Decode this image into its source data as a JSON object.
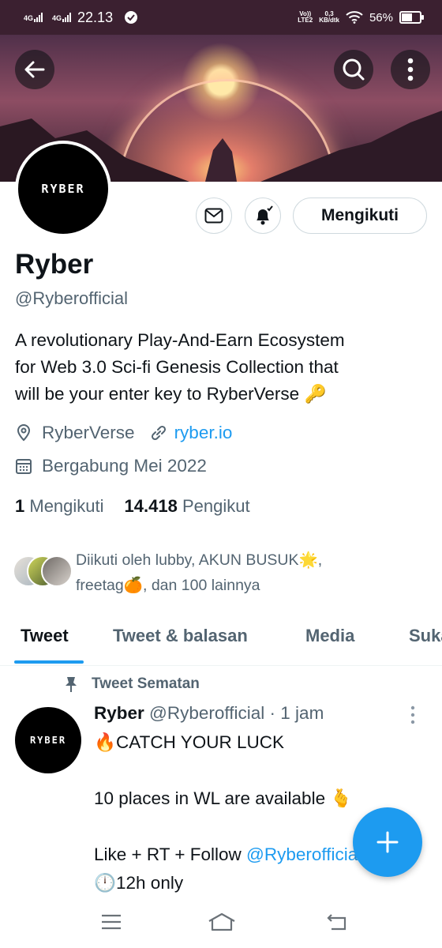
{
  "status_bar": {
    "network1": "4G",
    "network2": "4G",
    "time": "22.13",
    "volte_top": "Vo))",
    "volte_bottom": "LTE2",
    "speed_value": "0,3",
    "speed_unit": "KB/dtk",
    "battery": "56%",
    "battery_level": 0.56
  },
  "header": {
    "back_icon": "arrow-left-icon",
    "search_icon": "search-icon",
    "more_icon": "more-vertical-icon"
  },
  "profile": {
    "avatar_logo": "RYBER",
    "name": "Ryber",
    "handle": "@Ryberofficial",
    "bio_line1": "A revolutionary Play-And-Earn Ecosystem",
    "bio_line2": "for Web 3.0 Sci-fi Genesis Collection that",
    "bio_line3": "will be your enter key to RyberVerse",
    "bio_emoji": "🔑",
    "location": "RyberVerse",
    "website": "ryber.io",
    "joined": "Bergabung Mei 2022",
    "following_count": "1",
    "following_label": "Mengikuti",
    "followers_count": "14.418",
    "followers_label": "Pengikut",
    "follow_button": "Mengikuti"
  },
  "followed_by": {
    "line1": "Diikuti oleh lubby, AKUN BUSUK🌟,",
    "line2": "freetag🍊, dan 100 lainnya"
  },
  "tabs": [
    {
      "label": "Tweet"
    },
    {
      "label": "Tweet & balasan"
    },
    {
      "label": "Media"
    },
    {
      "label": "Suka"
    }
  ],
  "pinned_tweet": {
    "pinned_label": "Tweet Sematan",
    "author_name": "Ryber",
    "author_handle": "@Ryberofficial",
    "time": "· 1 jam",
    "line1": "🔥CATCH YOUR LUCK",
    "line2": "10 places in WL are available 🫰",
    "line3_prefix": "Like + RT + Follow ",
    "line3_mention": "@Ryberofficial",
    "line4": "🕛12h only"
  },
  "fab": {
    "icon": "plus-icon"
  },
  "nav_bar": {
    "menu_icon": "menu-icon",
    "home_icon": "home-icon",
    "back_icon": "back-icon"
  }
}
